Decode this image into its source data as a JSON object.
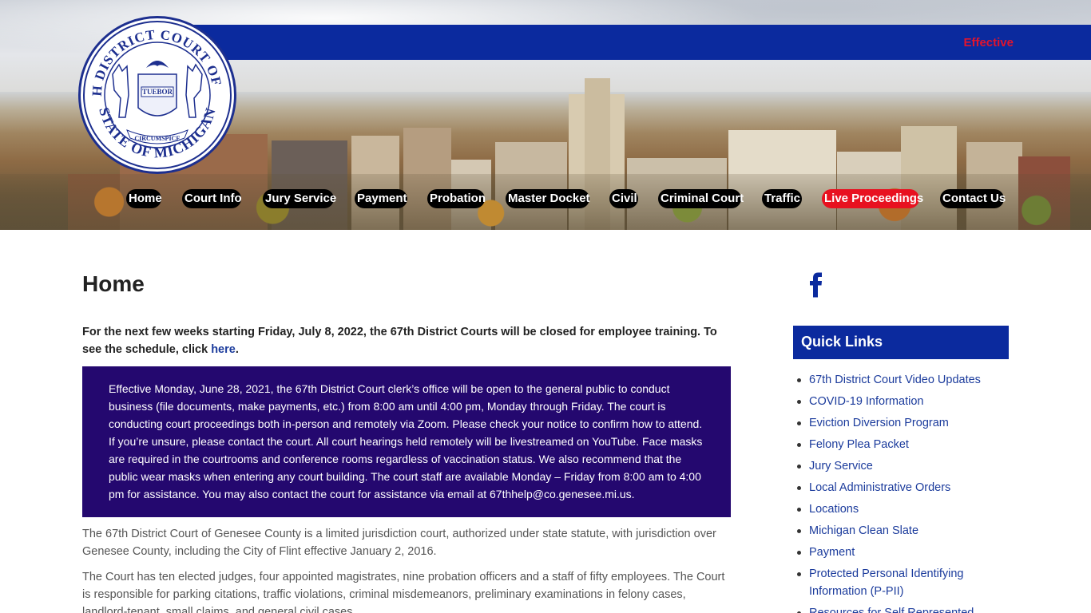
{
  "banner": {
    "text": "Effective"
  },
  "seal": {
    "outer_top": "67TH DISTRICT COURT OF THE",
    "outer_bottom": "STATE OF MICHIGAN",
    "motto": "TUEBOR",
    "ribbon": "CIRCUMSPICE"
  },
  "nav": [
    {
      "label": "Home"
    },
    {
      "label": "Court Info"
    },
    {
      "label": "Jury Service"
    },
    {
      "label": "Payment"
    },
    {
      "label": "Probation"
    },
    {
      "label": "Master Docket"
    },
    {
      "label": "Civil"
    },
    {
      "label": "Criminal Court"
    },
    {
      "label": "Traffic"
    },
    {
      "label": "Live Proceedings"
    },
    {
      "label": "Contact Us"
    }
  ],
  "main": {
    "title": "Home",
    "closure_text": "For the next few weeks starting Friday, July 8, 2022, the 67th District Courts will be closed for employee training. To see the schedule, click ",
    "closure_link": "here",
    "closure_end": ".",
    "notice": "Effective Monday, June 28, 2021, the 67th District Court clerk’s office will be open to the general public to conduct business (file documents, make payments, etc.) from 8:00 am until 4:00 pm, Monday through Friday. The court is conducting court proceedings both in-person and remotely via Zoom. Please check your notice to confirm how to attend. If you’re unsure, please contact the court. All court hearings held remotely will be livestreamed on YouTube. Face masks are required in the courtrooms and conference rooms regardless of vaccination status. We also recommend that the public wear masks when entering any court building. The court staff are available Monday – Friday from 8:00 am to 4:00 pm for assistance. You may also contact the court for assistance via email at 67thhelp@co.genesee.mi.us.",
    "para1": "The 67th District Court of Genesee County is a limited jurisdiction court, authorized under state statute, with jurisdiction over Genesee County, including the City of Flint effective January 2, 2016.",
    "para2": "The Court has ten elected judges, four appointed magistrates, nine probation officers and a staff of fifty employees. The Court is responsible for parking citations, traffic violations, criminal misdemeanors, preliminary examinations in felony cases, landlord-tenant, small claims, and general civil cases."
  },
  "sidebar": {
    "facebook_icon": "facebook-icon",
    "quick_links_title": "Quick Links",
    "links": [
      "67th District Court Video Updates",
      "COVID-19 Information",
      "Eviction Diversion Program",
      "Felony Plea Packet",
      "Jury Service",
      "Local Administrative Orders",
      "Locations",
      "Michigan Clean Slate",
      "Payment",
      "Protected Personal Identifying Information (P-PII)",
      "Resources for Self Represented"
    ]
  },
  "colors": {
    "brand_blue": "#0b2a9e",
    "notice_bg": "#24086f",
    "alert_red": "#e81120",
    "link_blue": "#1b3b9c"
  }
}
